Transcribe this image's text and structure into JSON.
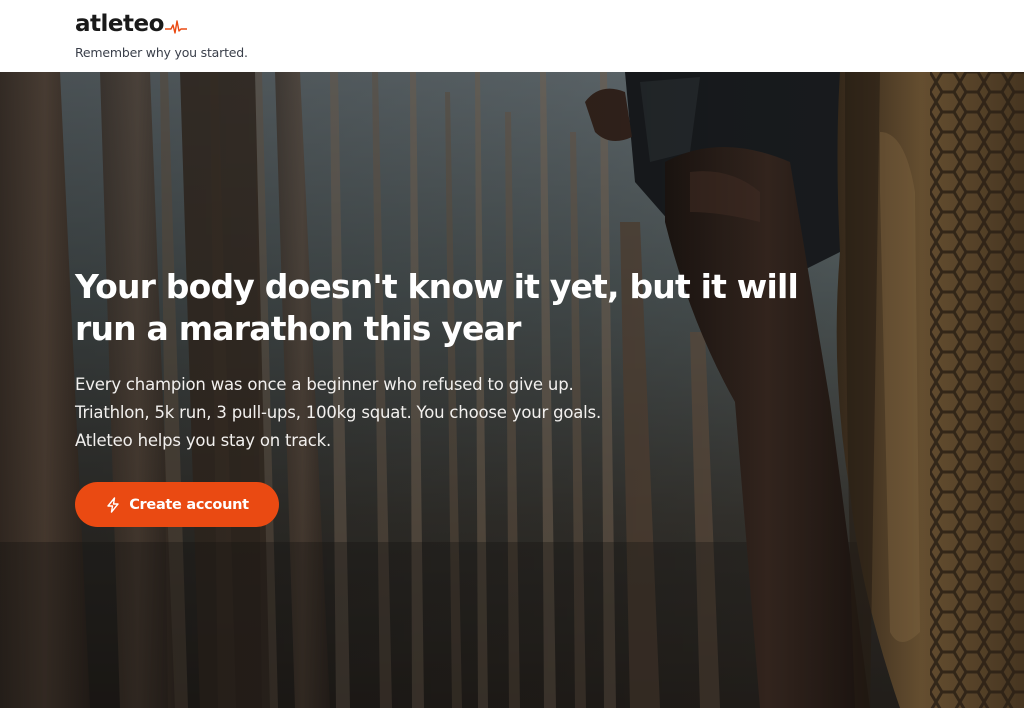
{
  "brand": {
    "logo_text": "atleteo",
    "tagline": "Remember why you started.",
    "accent_color": "#ea4a12"
  },
  "hero": {
    "title": "Your body doesn't know it yet, but it will run a marathon this year",
    "subtitle_lines": [
      "Every champion was once a beginner who refused to give up.",
      "Triathlon, 5k run, 3 pull-ups, 100kg squat. You choose your goals.",
      "Atleteo helps you stay on track."
    ],
    "cta": {
      "label": "Create account",
      "icon": "lightning-icon"
    },
    "background_image": "photo of a runner's legs and shoe in a eucalyptus forest, viewed from below"
  }
}
